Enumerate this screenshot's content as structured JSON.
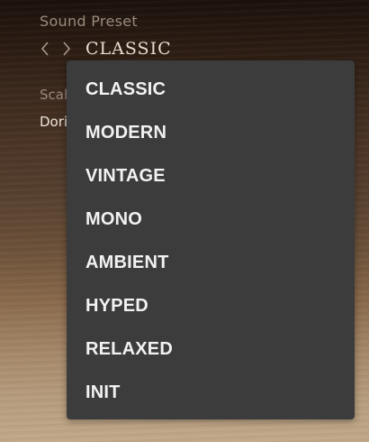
{
  "sound_preset": {
    "label": "Sound Preset",
    "prev_icon": "chevron-left-icon",
    "next_icon": "chevron-right-icon",
    "value": "CLASSIC"
  },
  "scale": {
    "label": "Scale",
    "value": "Dorian"
  },
  "dropdown": {
    "items": [
      {
        "label": "CLASSIC"
      },
      {
        "label": "MODERN"
      },
      {
        "label": "VINTAGE"
      },
      {
        "label": "MONO"
      },
      {
        "label": "AMBIENT"
      },
      {
        "label": "HYPED"
      },
      {
        "label": "RELAXED"
      },
      {
        "label": "INIT"
      }
    ]
  },
  "colors": {
    "menu_background": "#3c3c3c",
    "menu_text": "#f2f2f2",
    "label_text": "#9a8a7c",
    "value_text": "#e8dccf"
  }
}
